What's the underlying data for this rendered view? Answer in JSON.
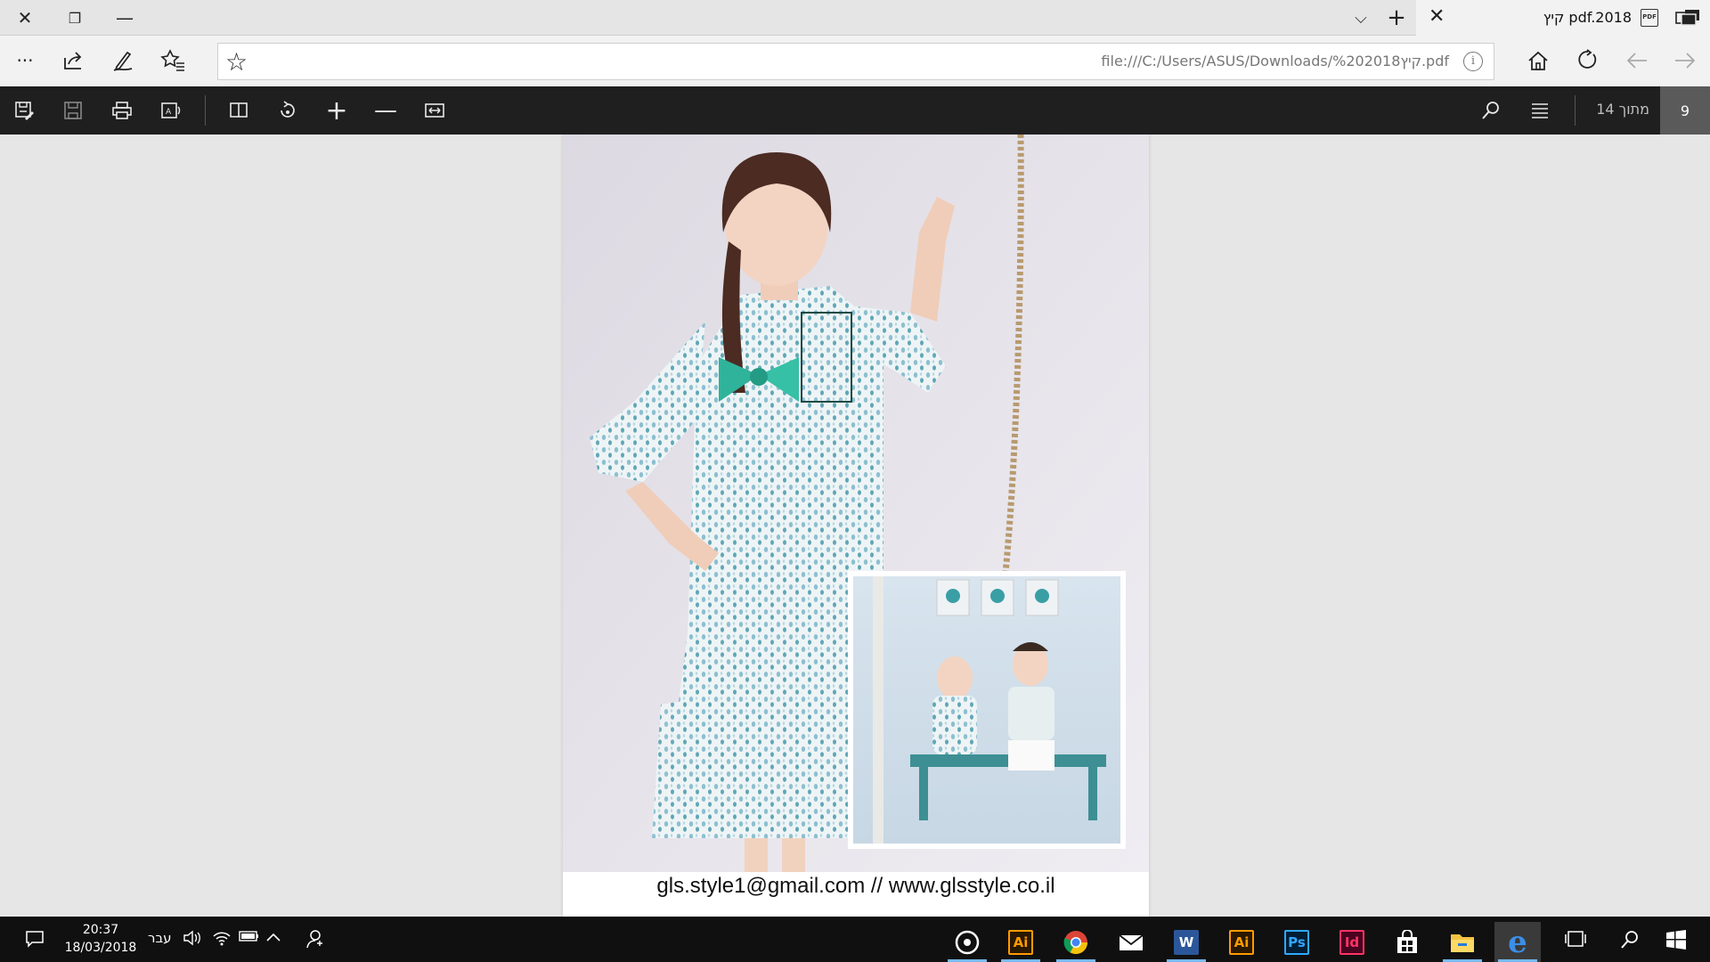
{
  "window": {
    "tab_title": "קיץ pdf.2018",
    "tab_pdf_badge": "PDF"
  },
  "address": {
    "url": "file:///C:/Users/ASUS/Downloads/קיץ%202018.pdf",
    "info": "i"
  },
  "pdf_toolbar": {
    "page_current": "9",
    "page_total_label": "מתוך 14"
  },
  "document": {
    "contact_line": "gls.style1@gmail.com // www.glsstyle.co.il"
  },
  "taskbar": {
    "time": "20:37",
    "date": "18/03/2018",
    "language": "עבר",
    "apps": [
      {
        "name": "groove",
        "label": ""
      },
      {
        "name": "illustrator-1",
        "label": "Ai"
      },
      {
        "name": "chrome",
        "label": ""
      },
      {
        "name": "mail",
        "label": ""
      },
      {
        "name": "word",
        "label": "W"
      },
      {
        "name": "illustrator-2",
        "label": "Ai"
      },
      {
        "name": "photoshop",
        "label": "Ps"
      },
      {
        "name": "indesign",
        "label": "Id"
      },
      {
        "name": "store",
        "label": ""
      },
      {
        "name": "file-explorer",
        "label": ""
      },
      {
        "name": "edge",
        "label": "e"
      }
    ]
  },
  "colors": {
    "pdf_toolbar_bg": "#1f1f1f",
    "taskbar_bg": "#101010",
    "accent": "#76b9ed",
    "ai": "#ff9a00",
    "ps": "#31a8ff",
    "id": "#ff3366",
    "word": "#2b579a"
  }
}
